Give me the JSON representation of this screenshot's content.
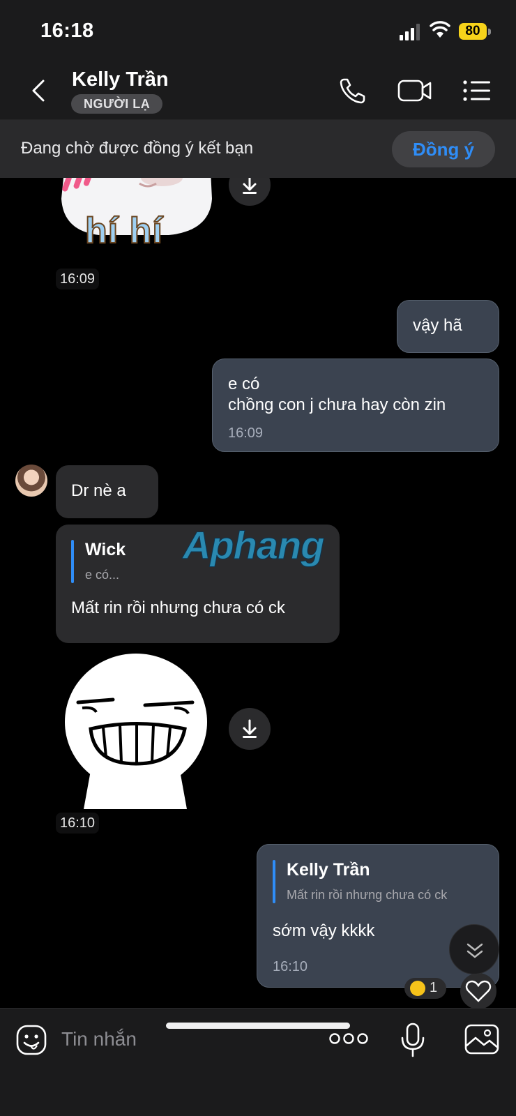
{
  "status_bar": {
    "time": "16:18",
    "battery": "80"
  },
  "header": {
    "contact_name": "Kelly Trần",
    "badge": "NGƯỜI LẠ"
  },
  "friend_request": {
    "text": "Đang chờ được đồng ý kết bạn",
    "accept_label": "Đồng ý"
  },
  "messages": {
    "sticker1": {
      "caption": "hí hí",
      "time": "16:09"
    },
    "out1": {
      "text": "vậy hã"
    },
    "out2": {
      "line1": "e có",
      "line2": "chồng con j chưa hay còn zin",
      "time": "16:09"
    },
    "in1": {
      "text": "Dr nè a"
    },
    "in2": {
      "quote_name": "Wick",
      "quote_snippet": "e có...",
      "text": "Mất rin rồi nhưng chưa có ck"
    },
    "watermark": "Aphang",
    "sticker2": {
      "time": "16:10"
    },
    "out3": {
      "quote_name": "Kelly Trần",
      "quote_snippet": "Mất rin rồi nhưng chưa có ck",
      "text": "sớm vậy kkkk",
      "time": "16:10",
      "reaction_count": "1"
    }
  },
  "composer": {
    "placeholder": "Tin nhắn"
  },
  "colors": {
    "accent": "#2f8df7",
    "outgoing_bubble": "#3b4350",
    "incoming_bubble": "#2b2b2d",
    "battery": "#f7d31a"
  }
}
